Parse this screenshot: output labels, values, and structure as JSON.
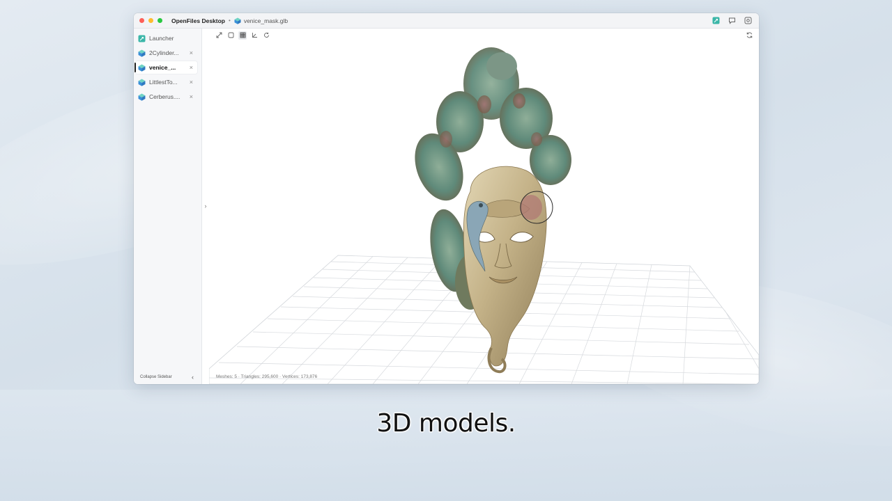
{
  "window": {
    "app_name": "OpenFiles Desktop",
    "separator": "•",
    "file_name": "venice_mask.glb"
  },
  "sidebar": {
    "items": [
      {
        "label": "Launcher",
        "icon": "launcher-icon",
        "closable": false,
        "active": false
      },
      {
        "label": "2Cylinder...",
        "icon": "cube-icon",
        "closable": true,
        "active": false
      },
      {
        "label": "venice_...",
        "icon": "cube-icon",
        "closable": true,
        "active": true
      },
      {
        "label": "LittlestTo...",
        "icon": "cube-icon",
        "closable": true,
        "active": false
      },
      {
        "label": "Cerberus....",
        "icon": "cube-icon",
        "closable": true,
        "active": false
      }
    ],
    "close_glyph": "×",
    "collapse_label": "Collapse Sidebar",
    "collapse_glyph": "‹",
    "expand_glyph": "›"
  },
  "viewer": {
    "tools": [
      "expand-icon",
      "box-icon",
      "grid-icon",
      "axes-icon",
      "rotate-icon"
    ],
    "active_tool": "grid-icon",
    "stats": "Meshes: 5 · Triangles: 295,600 · Vertices: 173,876"
  },
  "caption": "3D models.",
  "colors": {
    "accent": "#3bb6a8",
    "cube_blue": "#3a8fd8",
    "cube_teal": "#4cc3b2",
    "traffic_red": "#fe5f57",
    "traffic_yellow": "#febc2e",
    "traffic_green": "#28c840"
  }
}
